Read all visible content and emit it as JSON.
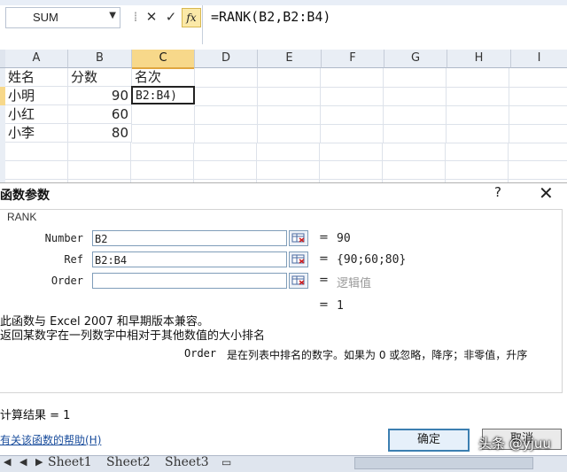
{
  "formula_bar": {
    "name_box": "SUM",
    "cancel_icon": "✕",
    "enter_icon": "✓",
    "fx_label": "fx",
    "formula": "=RANK(B2,B2:B4)"
  },
  "sheet": {
    "columns": [
      "A",
      "B",
      "C",
      "D",
      "E",
      "F",
      "G",
      "H",
      "I"
    ],
    "rows": [
      [
        "姓名",
        "分数",
        "名次"
      ],
      [
        "小明",
        "90",
        "B2:B4)"
      ],
      [
        "小红",
        "60",
        ""
      ],
      [
        "小李",
        "80",
        ""
      ]
    ]
  },
  "dialog": {
    "title": "函数参数",
    "help_icon": "?",
    "close_icon": "✕",
    "function_name": "RANK",
    "args": [
      {
        "label": "Number",
        "value": "B2",
        "result": "90"
      },
      {
        "label": "Ref",
        "value": "B2:B4",
        "result": "{90;60;80}"
      },
      {
        "label": "Order",
        "value": "",
        "result": "逻辑值"
      }
    ],
    "eq_sign": "=",
    "formula_result_inline": "1",
    "compat_note": "此函数与 Excel 2007 和早期版本兼容。",
    "description": "返回某数字在一列数字中相对于其他数值的大小排名",
    "arg_help_name": "Order",
    "arg_help_text": "是在列表中排名的数字。如果为 0 或忽略，降序；非零值，升序",
    "calc_result": "计算结果 =  1",
    "help_link": "有关该函数的帮助(H)",
    "ok": "确定",
    "cancel": "取消"
  },
  "tabs": [
    "Sheet1",
    "Sheet2",
    "Sheet3"
  ],
  "watermark": "头条 @yjuu"
}
